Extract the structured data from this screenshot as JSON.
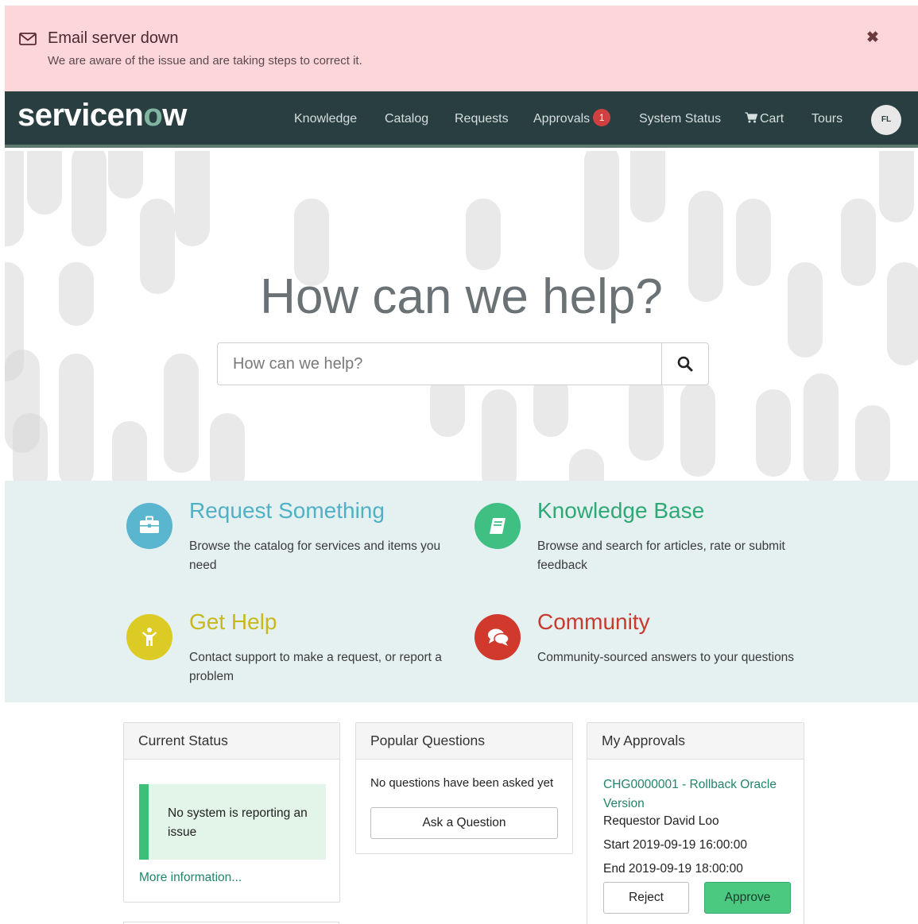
{
  "alert": {
    "title": "Email server down",
    "message": "We are aware of the issue and are taking steps to correct it.",
    "icon": "envelope-icon",
    "close_icon": "close-icon",
    "close_glyph": "✖"
  },
  "navbar": {
    "logo": {
      "pre": "servicen",
      "o": "o",
      "post": "w"
    },
    "items": {
      "knowledge": "Knowledge",
      "catalog": "Catalog",
      "requests": "Requests",
      "approvals": "Approvals",
      "approvals_badge": "1",
      "system_status": "System Status",
      "cart": "Cart",
      "tours": "Tours"
    },
    "avatar_initials": "FL",
    "colors": {
      "bar": "#293e40",
      "badge": "#d04040"
    }
  },
  "hero": {
    "title": "How can we help?",
    "search_placeholder": "How can we help?",
    "search_icon": "search-icon"
  },
  "tiles": {
    "request": {
      "title": "Request Something",
      "desc": "Browse the catalog for services and items you need",
      "icon": "briefcase-icon",
      "color": "#5ab5cf"
    },
    "knowledge": {
      "title": "Knowledge Base",
      "desc": "Browse and search for articles, rate or submit feedback",
      "icon": "book-icon",
      "color": "#3fbf82"
    },
    "help": {
      "title": "Get Help",
      "desc": "Contact support to make a request, or report a problem",
      "icon": "person-icon",
      "color": "#dccb24"
    },
    "community": {
      "title": "Community",
      "desc": "Community-sourced answers to your questions",
      "icon": "chat-icon",
      "color": "#d0392c"
    }
  },
  "cards": {
    "status": {
      "header": "Current Status",
      "message": "No system is reporting an issue",
      "link": "More information..."
    },
    "popular": {
      "header": "Popular Questions",
      "empty": "No questions have been asked yet",
      "ask_button": "Ask a Question"
    },
    "approvals": {
      "header": "My Approvals",
      "item_link": "CHG0000001 - Rollback Oracle Version",
      "requestor": "Requestor David Loo",
      "start": "Start 2019-09-19 16:00:00",
      "end": "End 2019-09-19 18:00:00",
      "reject_button": "Reject",
      "approve_button": "Approve"
    }
  }
}
